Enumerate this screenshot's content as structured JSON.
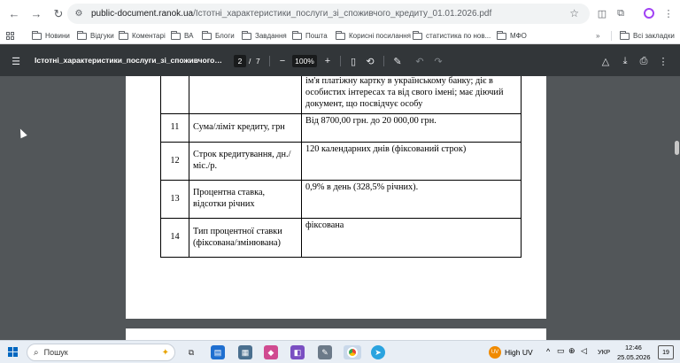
{
  "browser": {
    "url_host": "public-document.ranok.ua",
    "url_path": "/Істотні_характеристики_послуги_зі_споживчого_кредиту_01.01.2026.pdf"
  },
  "bookmarks": [
    {
      "label": "Новини"
    },
    {
      "label": "Відгуки"
    },
    {
      "label": "Коментарі"
    },
    {
      "label": "ВА"
    },
    {
      "label": "Блоги"
    },
    {
      "label": "Завдання"
    },
    {
      "label": "Пошта"
    },
    {
      "label": "Корисні посилання"
    },
    {
      "label": "статистика по нов..."
    },
    {
      "label": "МФО"
    }
  ],
  "bookmarks_all": "Всі закладки",
  "pdf": {
    "title": "Істотні_характеристики_послуги_зі_споживчого_кре...",
    "page_current": "2",
    "page_sep": "/",
    "page_total": "7",
    "zoom": "100%"
  },
  "table": {
    "top_cell": "ім'я платіжну картку в українському банку; діє в особистих інтересах та від свого імені; має діючий документ, що посвідчує особу",
    "rows": [
      {
        "num": "11",
        "label": "Сума/ліміт кредиту, грн",
        "value": "Від 8700,00 грн. до 20 000,00 грн."
      },
      {
        "num": "12",
        "label": "Строк кредитування, дн./міс./р.",
        "value": "120 календарних днів (фіксований строк)"
      },
      {
        "num": "13",
        "label": "Процентна ставка, відсотки річних",
        "value": "0,9% в день (328,5% річних)."
      },
      {
        "num": "14",
        "label": "Тип процентної ставки (фіксована/змінювана)",
        "value": "фіксована"
      }
    ]
  },
  "taskbar": {
    "search_placeholder": "Пошук",
    "weather": "High UV",
    "weather_badge": "UV",
    "lang": "УКР",
    "time": "12:46",
    "date": "25.05.2026",
    "notif_count": "19"
  }
}
